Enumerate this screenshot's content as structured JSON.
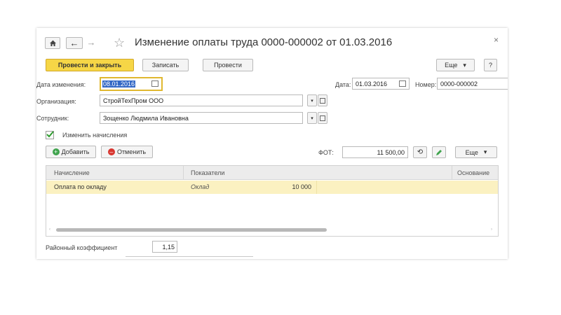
{
  "window": {
    "title": "Изменение оплаты труда 0000-000002 от 01.03.2016",
    "close_glyph": "×"
  },
  "nav": {
    "back": "←",
    "forward": "→",
    "star": "☆"
  },
  "toolbar": {
    "post_close": "Провести и закрыть",
    "save": "Записать",
    "post": "Провести",
    "more": "Еще",
    "more_arrow": "▾",
    "help": "?"
  },
  "form": {
    "change_date_label": "Дата изменения:",
    "change_date_value": "08.01.2016",
    "date_label": "Дата:",
    "date_value": "01.03.2016",
    "number_label": "Номер:",
    "number_value": "0000-000002",
    "org_label": "Организация:",
    "org_value": "СтройТехПром ООО",
    "emp_label": "Сотрудник:",
    "emp_value": "Зощенко Людмила Ивановна",
    "change_accruals_label": "Изменить начисления",
    "change_accruals_checked": true
  },
  "grid_toolbar": {
    "add": "Добавить",
    "cancel": "Отменить",
    "fot_label": "ФОТ:",
    "fot_value": "11 500,00",
    "more": "Еще"
  },
  "table": {
    "columns": [
      "Начисление",
      "Показатели",
      "Основание"
    ],
    "rows": [
      {
        "accrual": "Оплата по окладу",
        "indicator": "Оклад",
        "value": "10 000"
      }
    ]
  },
  "footer": {
    "regional_coef_label": "Районный коэффициент",
    "regional_coef_value": "1,15"
  },
  "colors": {
    "accent": "#f6d646",
    "selection": "#fbf1c1",
    "focus": "#e0b830"
  }
}
